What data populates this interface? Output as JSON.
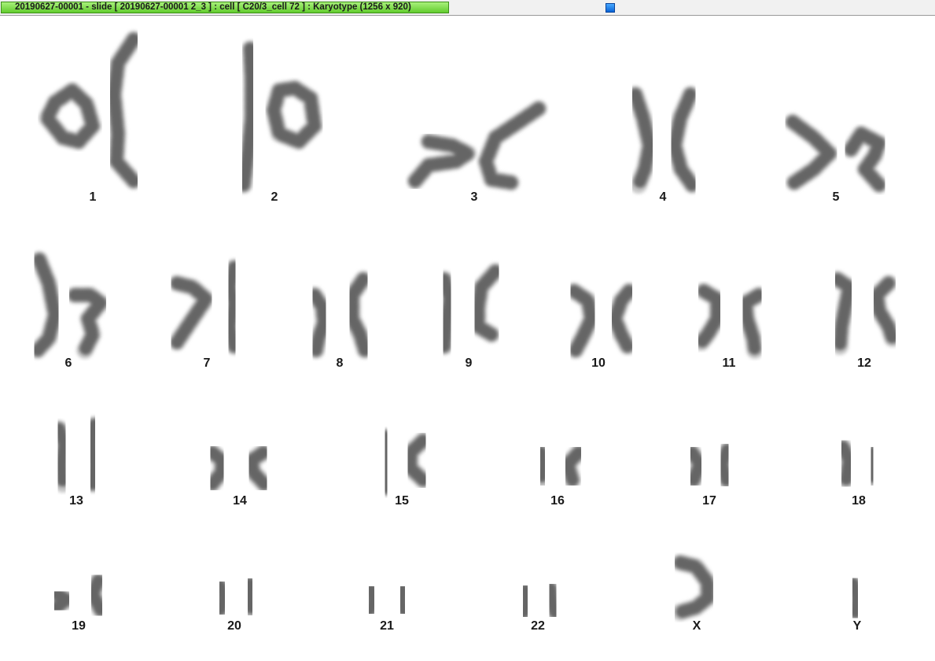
{
  "window": {
    "title": "20190627-00001 - slide [ 20190627-00001 2_3 ] : cell [ C20/3_cell 72 ] : Karyotype  (1256 x 920)"
  },
  "chromosome_color": "#555555",
  "karyotype": [
    {
      "label": "1"
    },
    {
      "label": "2"
    },
    {
      "label": "3"
    },
    {
      "label": "4"
    },
    {
      "label": "5"
    },
    {
      "label": "6"
    },
    {
      "label": "7"
    },
    {
      "label": "8"
    },
    {
      "label": "9"
    },
    {
      "label": "10"
    },
    {
      "label": "11"
    },
    {
      "label": "12"
    },
    {
      "label": "13"
    },
    {
      "label": "14"
    },
    {
      "label": "15"
    },
    {
      "label": "16"
    },
    {
      "label": "17"
    },
    {
      "label": "18"
    },
    {
      "label": "19"
    },
    {
      "label": "20"
    },
    {
      "label": "21"
    },
    {
      "label": "22"
    },
    {
      "label": "X"
    },
    {
      "label": "Y"
    }
  ]
}
